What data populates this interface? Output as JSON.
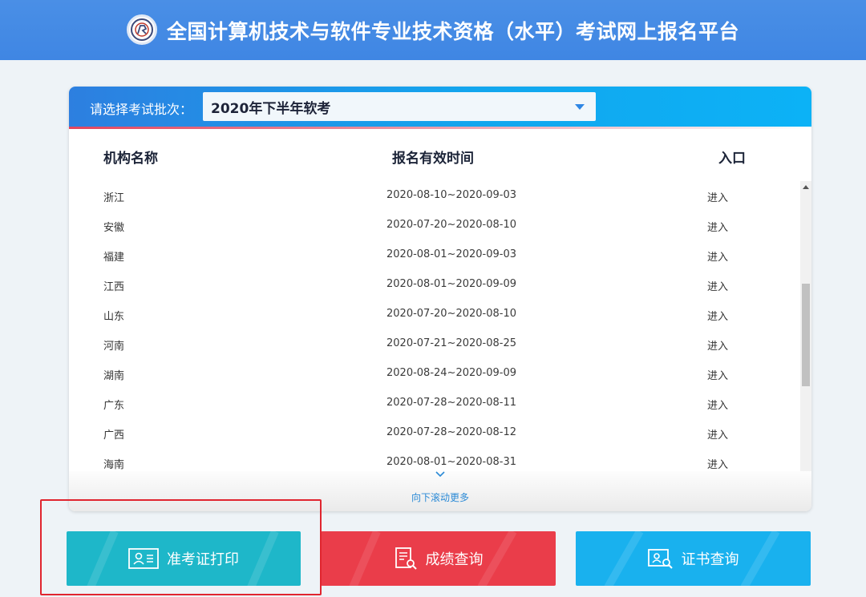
{
  "header": {
    "title": "全国计算机技术与软件专业技术资格（水平）考试网上报名平台",
    "logo_icon": "seal-logo-icon"
  },
  "batch": {
    "label": "请选择考试批次：",
    "selected": "2020年下半年软考"
  },
  "table": {
    "columns": [
      "机构名称",
      "报名有效时间",
      "入口"
    ],
    "rows": [
      {
        "org": "浙江",
        "time": "2020-08-10~2020-09-03",
        "entry": "进入"
      },
      {
        "org": "安徽",
        "time": "2020-07-20~2020-08-10",
        "entry": "进入"
      },
      {
        "org": "福建",
        "time": "2020-08-01~2020-09-03",
        "entry": "进入"
      },
      {
        "org": "江西",
        "time": "2020-08-01~2020-09-09",
        "entry": "进入"
      },
      {
        "org": "山东",
        "time": "2020-07-20~2020-08-10",
        "entry": "进入"
      },
      {
        "org": "河南",
        "time": "2020-07-21~2020-08-25",
        "entry": "进入"
      },
      {
        "org": "湖南",
        "time": "2020-08-24~2020-09-09",
        "entry": "进入"
      },
      {
        "org": "广东",
        "time": "2020-07-28~2020-08-11",
        "entry": "进入"
      },
      {
        "org": "广西",
        "time": "2020-07-28~2020-08-12",
        "entry": "进入"
      },
      {
        "org": "海南",
        "time": "2020-08-01~2020-08-31",
        "entry": "进入"
      }
    ],
    "more_label": "向下滚动更多"
  },
  "actions": {
    "admit_label": "准考证打印",
    "score_label": "成绩查询",
    "cert_label": "证书查询"
  },
  "colors": {
    "header": "#4a8fe6",
    "admit": "#1eb7c9",
    "score": "#ea3d4a",
    "cert": "#19b1ee",
    "highlight": "#e0252f"
  }
}
